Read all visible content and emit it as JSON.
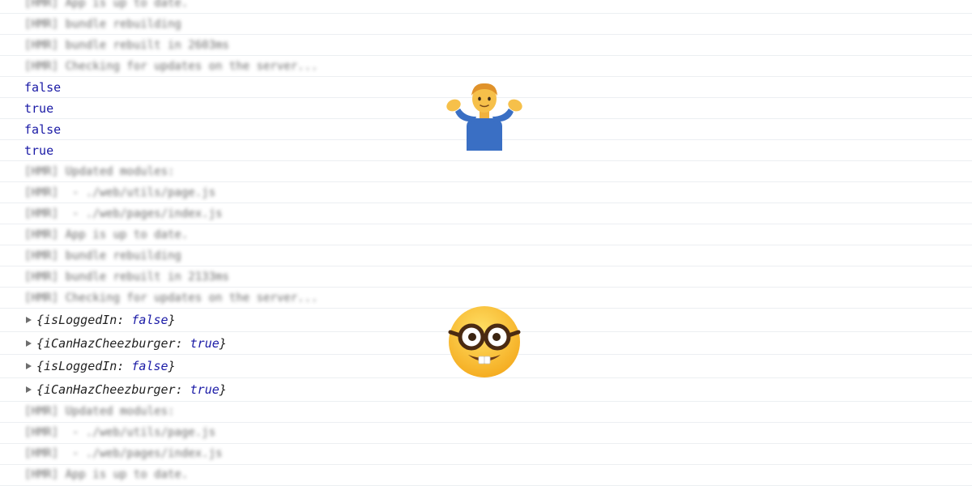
{
  "console": {
    "rows": [
      {
        "kind": "blurred",
        "text": "[HMR] App is up to date."
      },
      {
        "kind": "blurred",
        "text": "[HMR] bundle rebuilding"
      },
      {
        "kind": "blurred",
        "text": "[HMR] bundle rebuilt in 2603ms"
      },
      {
        "kind": "blurred",
        "text": "[HMR] Checking for updates on the server..."
      },
      {
        "kind": "bool",
        "text": "false"
      },
      {
        "kind": "bool",
        "text": "true"
      },
      {
        "kind": "bool",
        "text": "false"
      },
      {
        "kind": "bool",
        "text": "true"
      },
      {
        "kind": "blurred",
        "text": "[HMR] Updated modules:"
      },
      {
        "kind": "blurred",
        "text": "[HMR]  - ./web/utils/page.js"
      },
      {
        "kind": "blurred",
        "text": "[HMR]  - ./web/pages/index.js"
      },
      {
        "kind": "blurred",
        "text": "[HMR] App is up to date."
      },
      {
        "kind": "blurred",
        "text": "[HMR] bundle rebuilding"
      },
      {
        "kind": "blurred",
        "text": "[HMR] bundle rebuilt in 2133ms"
      },
      {
        "kind": "blurred",
        "text": "[HMR] Checking for updates on the server..."
      },
      {
        "kind": "object",
        "key": "isLoggedIn",
        "value": "false"
      },
      {
        "kind": "object",
        "key": "iCanHazCheezburger",
        "value": "true"
      },
      {
        "kind": "object",
        "key": "isLoggedIn",
        "value": "false"
      },
      {
        "kind": "object",
        "key": "iCanHazCheezburger",
        "value": "true"
      },
      {
        "kind": "blurred",
        "text": "[HMR] Updated modules:"
      },
      {
        "kind": "blurred",
        "text": "[HMR]  - ./web/utils/page.js"
      },
      {
        "kind": "blurred",
        "text": "[HMR]  - ./web/pages/index.js"
      },
      {
        "kind": "blurred",
        "text": "[HMR] App is up to date."
      }
    ]
  },
  "emojis": {
    "shrug": "person-shrugging-icon",
    "nerd": "nerd-face-icon"
  },
  "colors": {
    "boolean": "#1a1aa6",
    "row_border": "#eceff2",
    "expander": "#6e6e6e"
  }
}
